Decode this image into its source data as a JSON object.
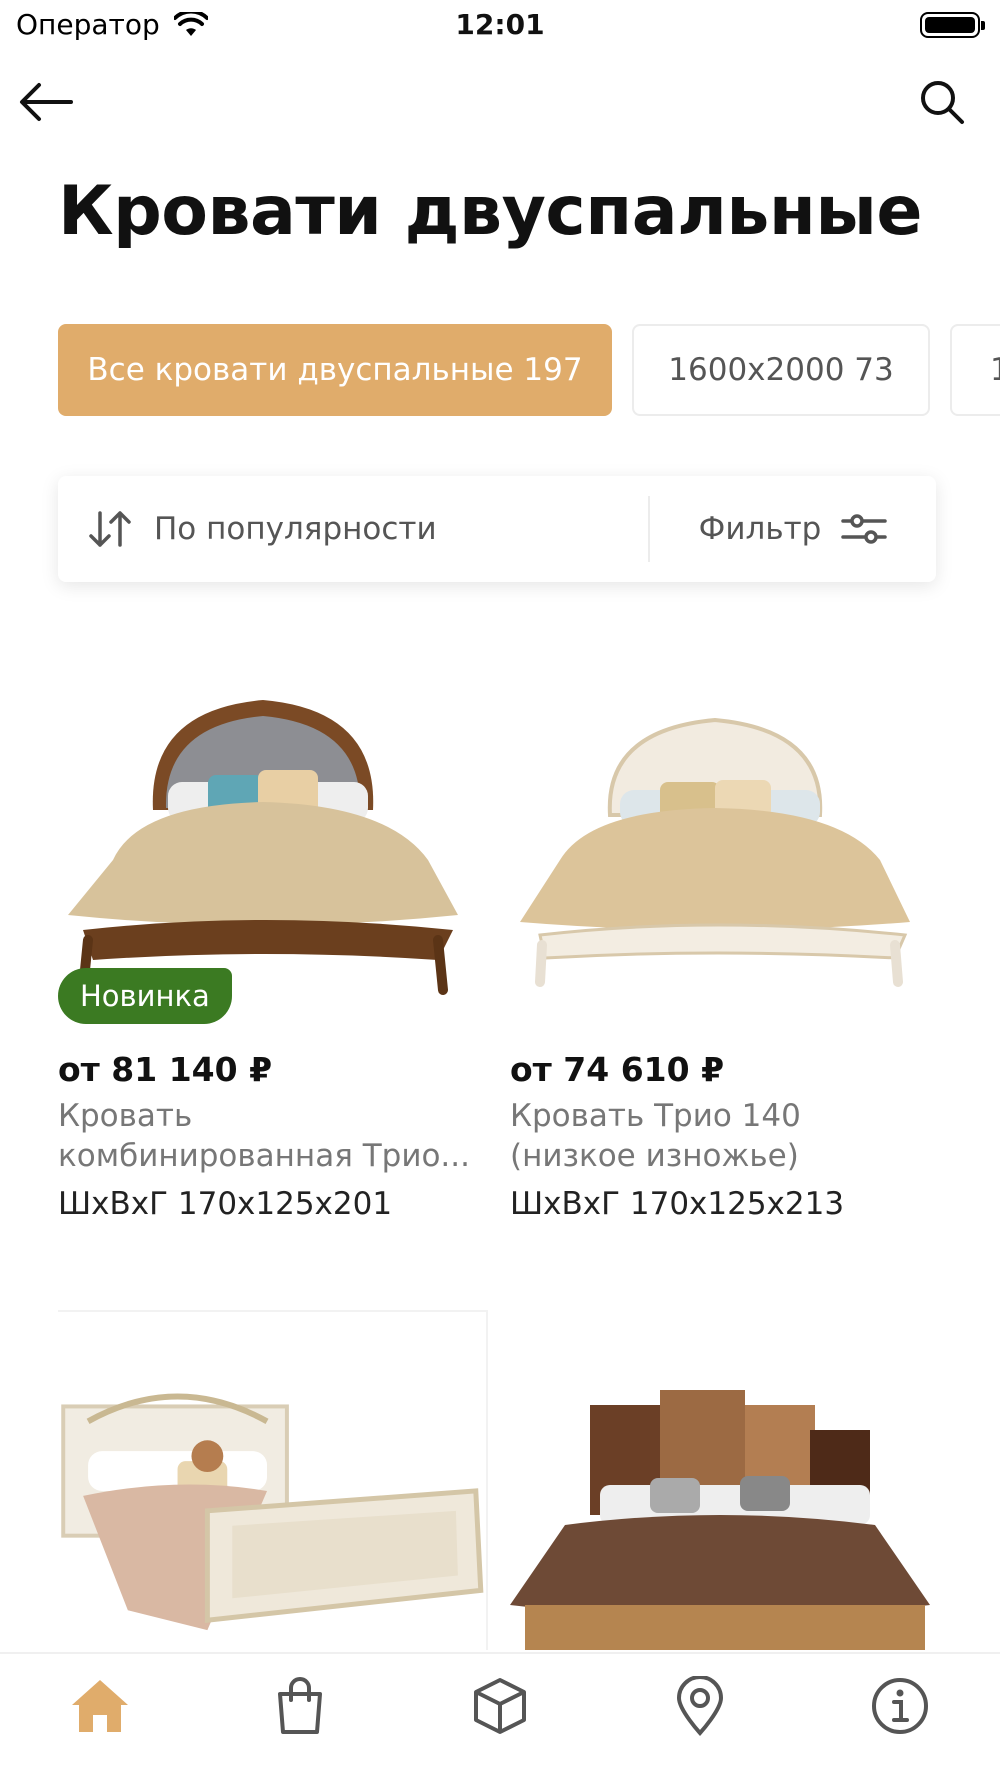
{
  "status_bar": {
    "carrier": "Оператор",
    "time": "12:01"
  },
  "nav": {
    "back_icon": "arrow-left-icon",
    "search_icon": "search-icon"
  },
  "page": {
    "title": "Кровати двуспальные"
  },
  "chips": [
    {
      "label": "Все кровати двуспальные 197",
      "active": true
    },
    {
      "label": "1600x2000 73",
      "active": false
    },
    {
      "label": "1",
      "active": false
    }
  ],
  "sort": {
    "label": "По популярности",
    "icon": "sort-arrows-icon"
  },
  "filter": {
    "label": "Фильтр",
    "icon": "sliders-icon"
  },
  "products": [
    {
      "badge": "Новинка",
      "price": "от 81 140 ₽",
      "name_line1": "Кровать",
      "name_line2": "комбинированная Трио...",
      "dims": "ШхВхГ 170x125x201"
    },
    {
      "badge": "",
      "price": "от 74 610 ₽",
      "name_line1": "Кровать Трио 140",
      "name_line2": "(низкое изножье)",
      "dims": "ШхВхГ 170x125x213"
    }
  ],
  "colors": {
    "accent": "#e0ac6b",
    "badge_new": "#3b7a22",
    "active_tab": "#e0ac6b"
  },
  "tabbar": {
    "tabs": [
      {
        "icon": "home-icon",
        "active": true
      },
      {
        "icon": "shopping-bag-icon",
        "active": false
      },
      {
        "icon": "box-icon",
        "active": false
      },
      {
        "icon": "location-pin-icon",
        "active": false
      },
      {
        "icon": "info-icon",
        "active": false
      }
    ]
  }
}
